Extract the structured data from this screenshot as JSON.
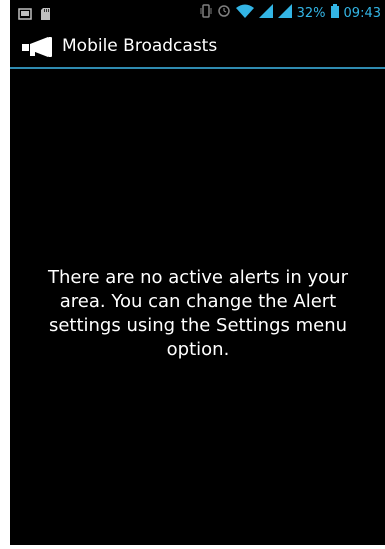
{
  "status_bar": {
    "battery_percent": "32%",
    "time": "09:43",
    "notification_icons": [
      "screenshot-icon",
      "sd-card-icon"
    ],
    "system_icons": [
      "vibrate-icon",
      "alarm-icon",
      "wifi-icon",
      "signal-icon",
      "signal-icon",
      "battery-icon"
    ]
  },
  "action_bar": {
    "title": "Mobile Broadcasts",
    "icon": "megaphone-icon"
  },
  "main": {
    "message": "There are no active alerts in your area. You can change the Alert settings using the Settings menu option."
  },
  "colors": {
    "background": "#000000",
    "status_accent": "#33b5e5",
    "divider": "#2f8bb0",
    "text": "#ffffff"
  }
}
